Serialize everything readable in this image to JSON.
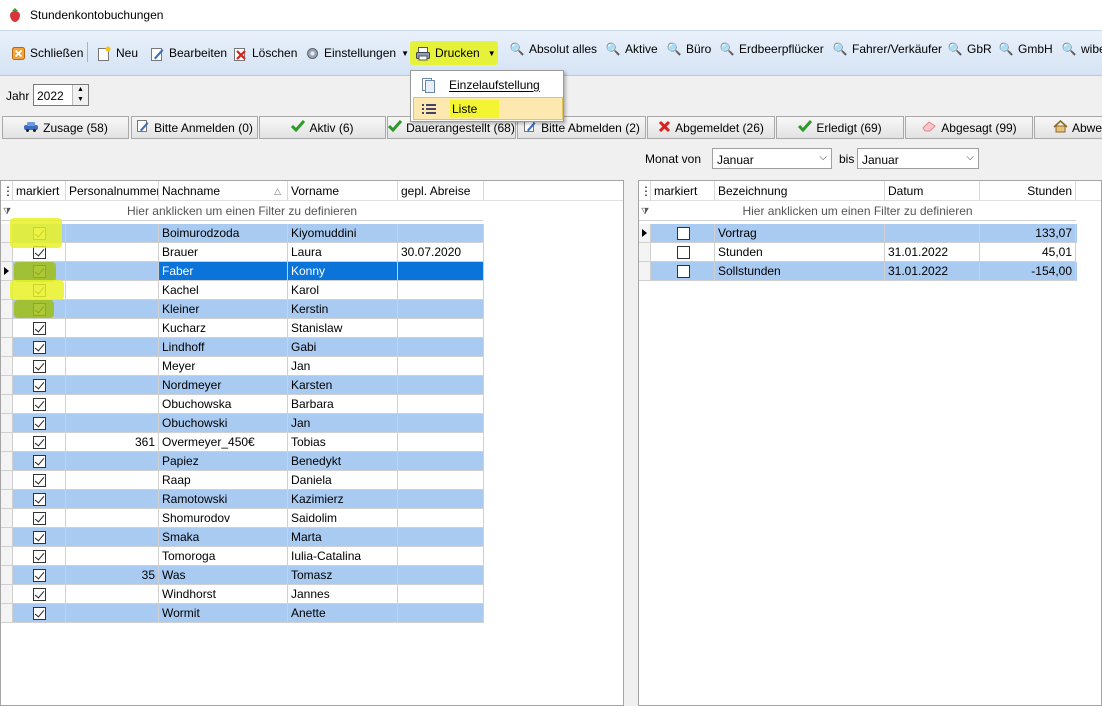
{
  "window": {
    "title": "Stundenkontobuchungen"
  },
  "toolbar": {
    "close_label": "Schließen",
    "new_label": "Neu",
    "edit_label": "Bearbeiten",
    "delete_label": "Löschen",
    "settings_label": "Einstellungen",
    "print_label": "Drucken",
    "filters": [
      "Absolut alles",
      "Aktive",
      "Büro",
      "Erdbeerpflücker",
      "Fahrer/Verkäufer",
      "GbR",
      "GmbH",
      "wibe"
    ]
  },
  "print_menu": {
    "items": [
      {
        "label": "Einzelaufstellung",
        "selected": false
      },
      {
        "label": "Liste",
        "selected": true
      }
    ]
  },
  "year": {
    "label": "Jahr",
    "value": "2022"
  },
  "status_tabs": [
    {
      "label": "Zusage (58)",
      "icon": "car-icon"
    },
    {
      "label": "Bitte Anmelden (0)",
      "icon": "pencil-icon"
    },
    {
      "label": "Aktiv (6)",
      "icon": "check-icon"
    },
    {
      "label": "Dauerangestellt (68)",
      "icon": "check-icon"
    },
    {
      "label": "Bitte Abmelden (2)",
      "icon": "pencil-icon"
    },
    {
      "label": "Abgemeldet (26)",
      "icon": "x-icon"
    },
    {
      "label": "Erledigt (69)",
      "icon": "check-icon"
    },
    {
      "label": "Abgesagt (99)",
      "icon": "eraser-icon"
    },
    {
      "label": "Abwe",
      "icon": "house-icon"
    }
  ],
  "month_filter": {
    "from_label": "Monat von",
    "from_value": "Januar",
    "to_label": "bis",
    "to_value": "Januar"
  },
  "left_grid": {
    "columns": [
      "markiert",
      "Personalnummer",
      "Nachname",
      "Vorname",
      "gepl. Abreise"
    ],
    "filter_hint": "Hier anklicken um einen Filter zu definieren",
    "rows": [
      {
        "pn": "",
        "last": "Boimurodzoda",
        "first": "Kiyomuddini",
        "abr": ""
      },
      {
        "pn": "",
        "last": "Brauer",
        "first": "Laura",
        "abr": "30.07.2020"
      },
      {
        "pn": "",
        "last": "Faber",
        "first": "Konny",
        "abr": ""
      },
      {
        "pn": "",
        "last": "Kachel",
        "first": "Karol",
        "abr": ""
      },
      {
        "pn": "",
        "last": "Kleiner",
        "first": "Kerstin",
        "abr": ""
      },
      {
        "pn": "",
        "last": "Kucharz",
        "first": "Stanislaw",
        "abr": ""
      },
      {
        "pn": "",
        "last": "Lindhoff",
        "first": "Gabi",
        "abr": ""
      },
      {
        "pn": "",
        "last": "Meyer",
        "first": "Jan",
        "abr": ""
      },
      {
        "pn": "",
        "last": "Nordmeyer",
        "first": "Karsten",
        "abr": ""
      },
      {
        "pn": "",
        "last": "Obuchowska",
        "first": "Barbara",
        "abr": ""
      },
      {
        "pn": "",
        "last": "Obuchowski",
        "first": "Jan",
        "abr": ""
      },
      {
        "pn": "361",
        "last": "Overmeyer_450€",
        "first": "Tobias",
        "abr": ""
      },
      {
        "pn": "",
        "last": "Papiez",
        "first": "Benedykt",
        "abr": ""
      },
      {
        "pn": "",
        "last": "Raap",
        "first": "Daniela",
        "abr": ""
      },
      {
        "pn": "",
        "last": "Ramotowski",
        "first": "Kazimierz",
        "abr": ""
      },
      {
        "pn": "",
        "last": "Shomurodov",
        "first": "Saidolim",
        "abr": ""
      },
      {
        "pn": "",
        "last": "Smaka",
        "first": "Marta",
        "abr": ""
      },
      {
        "pn": "",
        "last": "Tomoroga",
        "first": "Iulia-Catalina",
        "abr": ""
      },
      {
        "pn": "35",
        "last": "Was",
        "first": "Tomasz",
        "abr": ""
      },
      {
        "pn": "",
        "last": "Windhorst",
        "first": "Jannes",
        "abr": ""
      },
      {
        "pn": "",
        "last": "Wormit",
        "first": "Anette",
        "abr": ""
      }
    ]
  },
  "right_grid": {
    "columns": [
      "markiert",
      "Bezeichnung",
      "Datum",
      "Stunden"
    ],
    "filter_hint": "Hier anklicken um einen Filter zu definieren",
    "rows": [
      {
        "bez": "Vortrag",
        "datum": "",
        "std": "133,07"
      },
      {
        "bez": "Stunden",
        "datum": "31.01.2022",
        "std": "45,01"
      },
      {
        "bez": "Sollstunden",
        "datum": "31.01.2022",
        "std": "-154,00"
      }
    ]
  }
}
